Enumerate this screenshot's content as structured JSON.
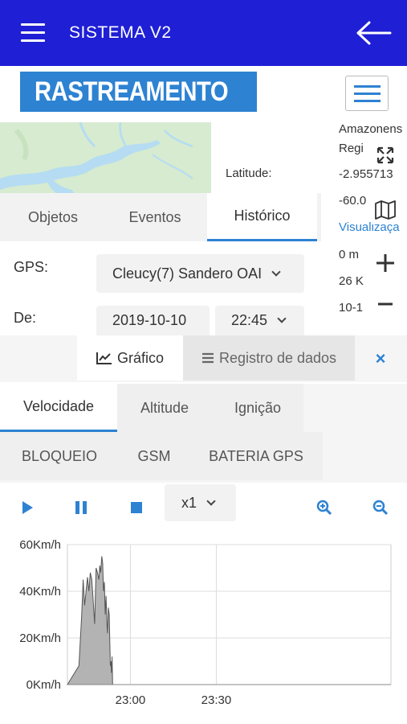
{
  "app": {
    "title": "SISTEMA V2"
  },
  "logo": {
    "text": "RASTREAMENTO"
  },
  "vehicle_info": {
    "latitude_label": "Latitude:",
    "region_text": "Amazonens",
    "region_label": "Regi",
    "latitude_value": "-2.955713",
    "longitude_value": "-60.0",
    "view_link": "Visualizaça",
    "distance": "0 m",
    "km": "26 K",
    "date": "10-1"
  },
  "tabs": [
    {
      "label": "Objetos"
    },
    {
      "label": "Eventos"
    },
    {
      "label": "Histórico"
    }
  ],
  "form": {
    "gps_label": "GPS:",
    "gps_value": "Cleucy(7) Sandero OAI",
    "from_label": "De:",
    "date_value": "2019-10-10",
    "time_value": "22:45"
  },
  "graph_panel": {
    "grafico_label": "Gráfico",
    "registro_label": "Registro de dados",
    "close_label": "×"
  },
  "metric_tabs": [
    {
      "label": "Velocidade"
    },
    {
      "label": "Altitude"
    },
    {
      "label": "Ignição"
    },
    {
      "label": "BLOQUEIO"
    },
    {
      "label": "GSM"
    },
    {
      "label": "BATERIA GPS"
    }
  ],
  "player": {
    "speed": "x1"
  },
  "colors": {
    "topbar": "#1f1fd6",
    "accent": "#2d82d2",
    "area_fill": "#b3b3b3"
  },
  "chart_data": {
    "type": "area",
    "y_ticks": [
      "0Km/h",
      "20Km/h",
      "40Km/h",
      "60Km/h"
    ],
    "x_ticks": [
      "23:00",
      "23:30"
    ],
    "ylim": [
      0,
      60
    ],
    "series": [
      {
        "values": [
          [
            0,
            0
          ],
          [
            2,
            4
          ],
          [
            4,
            8
          ],
          [
            5,
            30
          ],
          [
            5.5,
            45
          ],
          [
            6,
            34
          ],
          [
            7,
            46
          ],
          [
            7.5,
            40
          ],
          [
            8,
            48
          ],
          [
            8.5,
            45
          ],
          [
            9,
            36
          ],
          [
            9.5,
            26
          ],
          [
            10,
            50
          ],
          [
            10.5,
            48
          ],
          [
            11,
            45
          ],
          [
            11.3,
            51
          ],
          [
            11.6,
            48
          ],
          [
            12,
            55
          ],
          [
            12.3,
            52
          ],
          [
            12.6,
            40
          ],
          [
            12.9,
            44
          ],
          [
            13.2,
            30
          ],
          [
            13.5,
            38
          ],
          [
            13.8,
            26
          ],
          [
            14,
            22
          ],
          [
            14.3,
            33
          ],
          [
            14.6,
            30
          ],
          [
            14.8,
            18
          ],
          [
            15,
            8
          ],
          [
            15.2,
            10
          ],
          [
            15.4,
            5
          ],
          [
            15.6,
            12
          ],
          [
            15.8,
            0
          ],
          [
            16,
            0
          ]
        ]
      }
    ]
  }
}
